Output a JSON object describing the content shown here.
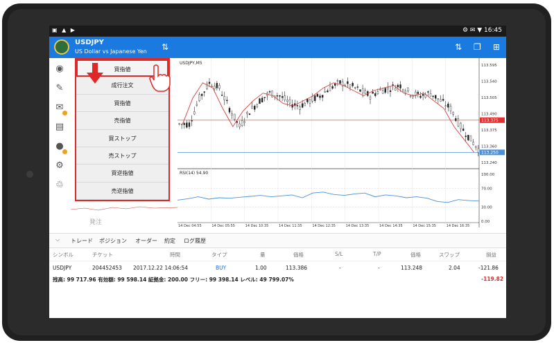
{
  "statusbar": {
    "left_icons": "▣ ▲ ▶",
    "right_text": "⚙ ✉ ▼ 16:45"
  },
  "appbar": {
    "symbol": "USDJPY",
    "description": "US Dollar vs Japanese Yen"
  },
  "chart": {
    "title": "USDJPY,M5",
    "rsi_label": "RSI(14) 54.90",
    "price_ticks": [
      "113.595",
      "113.540",
      "113.505",
      "113.490",
      "113.375",
      "113.360",
      "113.240"
    ],
    "rsi_ticks": [
      "100.00",
      "70.00",
      "30.00",
      "0.00"
    ],
    "time_ticks": [
      "14 Dec 04:55",
      "14 Dec 05:55",
      "14 Dec 10:35",
      "14 Dec 11:35",
      "14 Dec 12:35",
      "14 Dec 13:35",
      "14 Dec 14:35",
      "14 Dec 15:35",
      "14 Dec 16:35"
    ],
    "bid_label": "113.375",
    "ask_label": "113.250",
    "colors": {
      "bid": "#e03030",
      "ask": "#4a90d9",
      "ma": "#d84040",
      "rsi": "#4a90d9"
    }
  },
  "chart_data": {
    "type": "line",
    "title": "USDJPY,M5",
    "series": [
      {
        "name": "",
        "values": [
          113.36,
          113.46,
          113.52,
          113.5,
          113.42,
          113.35,
          113.41,
          113.45,
          113.48,
          113.47,
          113.44,
          113.43,
          113.45,
          113.47,
          113.5,
          113.52,
          113.51,
          113.49,
          113.47,
          113.49,
          113.5,
          113.51,
          113.48,
          113.47,
          113.48,
          113.45,
          113.42,
          113.35,
          113.3,
          113.25
        ]
      },
      {
        "name": "RSI(14) 54.90",
        "values": [
          45,
          48,
          52,
          47,
          50,
          49,
          51,
          53,
          55,
          52,
          54,
          56,
          50,
          60,
          62,
          57,
          55,
          58,
          60,
          52,
          56,
          54,
          50,
          52,
          49,
          42,
          40,
          46,
          44,
          43
        ]
      }
    ],
    "ylim": [
      113.2,
      113.6
    ],
    "rsi_ylim": [
      0,
      100
    ]
  },
  "menu": {
    "items": [
      "買指値",
      "成行注文",
      "買指値",
      "売指値",
      "買ストップ",
      "売ストップ",
      "買逆指値",
      "売逆指値"
    ]
  },
  "order_button": "発注",
  "tabs": [
    "トレード",
    "ポジション",
    "オーダー",
    "約定",
    "ログ履歴"
  ],
  "table": {
    "headers": [
      "シンボル",
      "チケット",
      "時間",
      "タイプ",
      "量",
      "価格",
      "S/L",
      "T/P",
      "価格",
      "スワップ",
      "損益"
    ],
    "row": [
      "USDJPY",
      "204452453",
      "2017.12.22 14:06:54",
      "BUY",
      "1.00",
      "113.386",
      "-",
      "-",
      "113.248",
      "2.04",
      "-121.86"
    ],
    "summary": "残高: 99 717.96  有効額: 99 598.14  証拠金: 200.00  フリー: 99 398.14  レベル: 49 799.07%",
    "summary_pl": "-119.82",
    "buy_color": "#1a6fd8",
    "loss_color": "#e02828"
  }
}
